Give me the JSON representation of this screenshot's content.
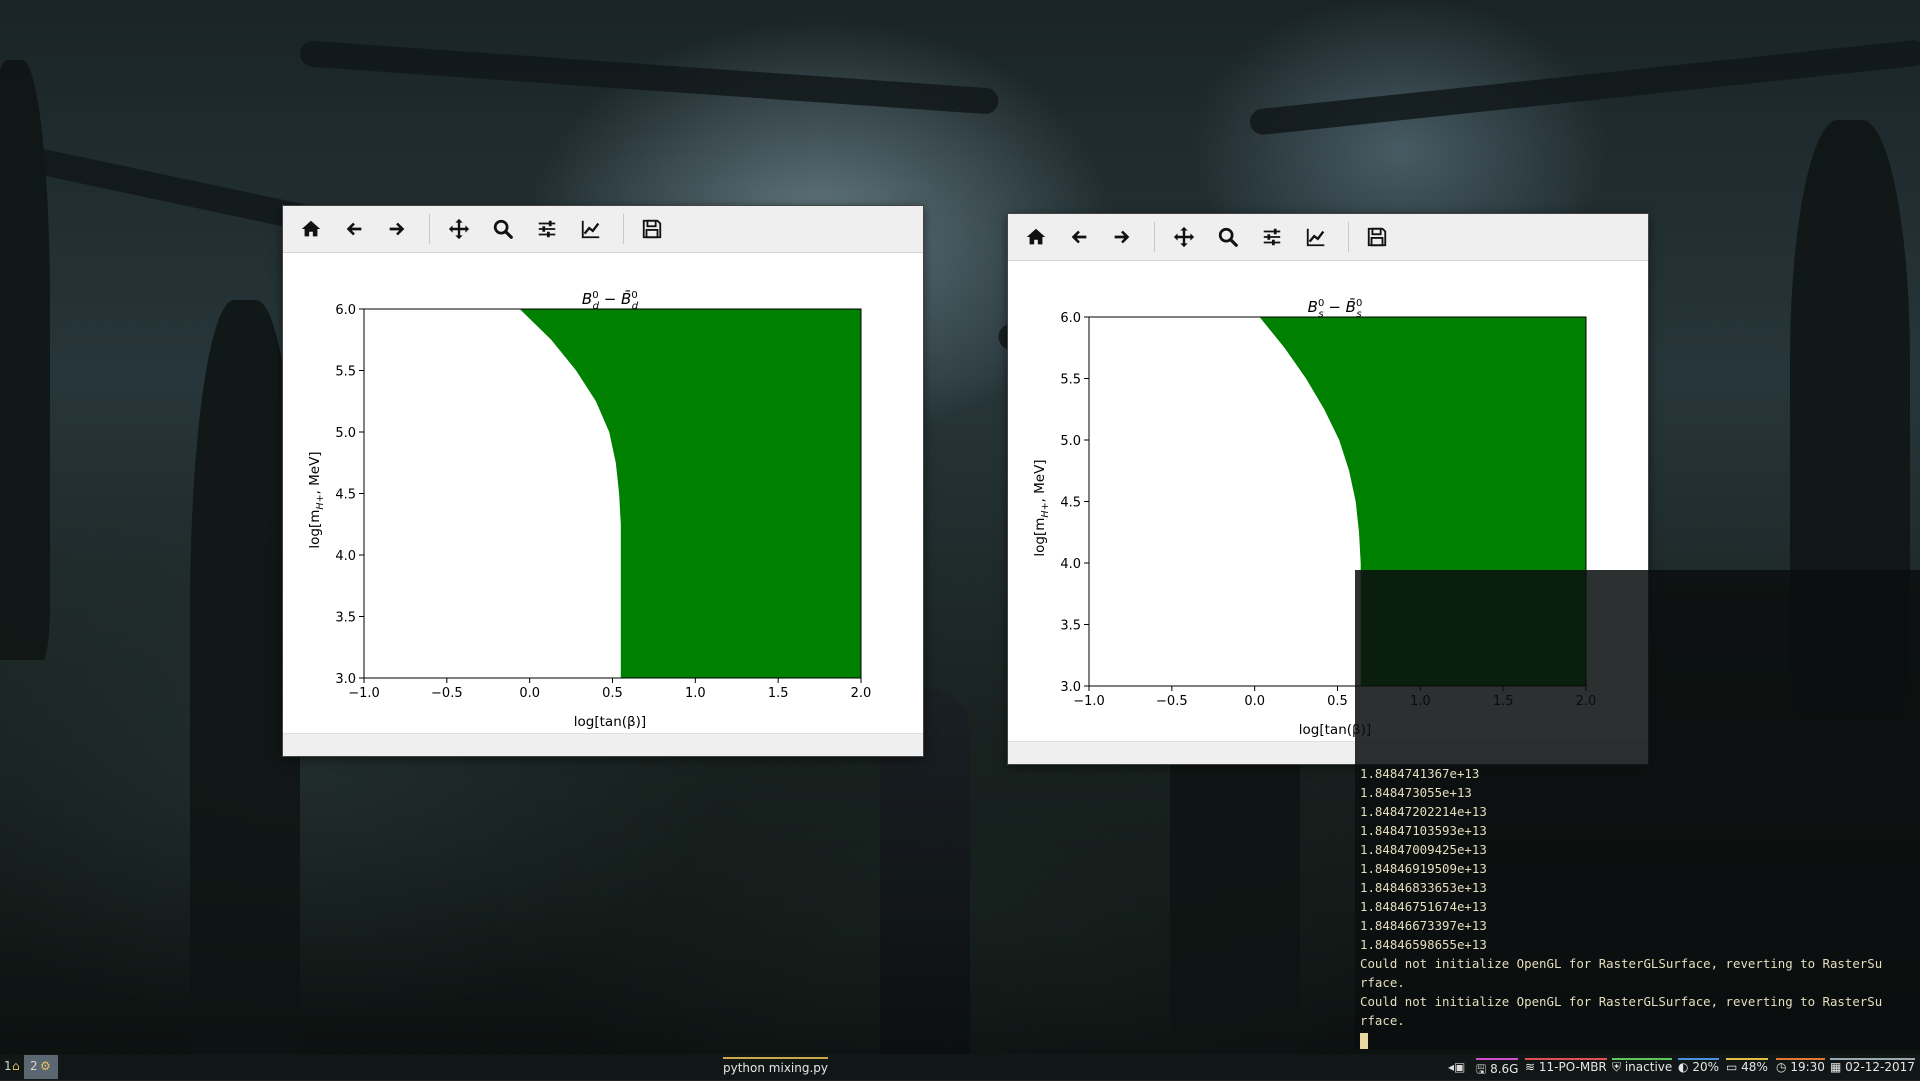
{
  "windows": [
    {
      "id": "bd",
      "title_main": "B",
      "title_sup1": "0",
      "title_sub1": "d",
      "title_minus": " − ",
      "title_main2": "B̄",
      "title_sup2": "0",
      "title_sub2": "d",
      "xlabel": "log[tan(β)]",
      "ylabel_pre": "log[m",
      "ylabel_sub": "H+",
      "ylabel_post": ", MeV]"
    },
    {
      "id": "bs",
      "title_main": "B",
      "title_sup1": "0",
      "title_sub1": "s",
      "title_minus": " − ",
      "title_main2": "B̄",
      "title_sup2": "0",
      "title_sub2": "s",
      "xlabel": "log[tan(β)]",
      "ylabel_pre": "log[m",
      "ylabel_sub": "H+",
      "ylabel_post": ", MeV]"
    }
  ],
  "chart_data": [
    {
      "type": "area",
      "title": "B_d^0 − B̄_d^0",
      "xlabel": "log[tan(β)]",
      "ylabel": "log[m_H+, MeV]",
      "xlim": [
        -1.0,
        2.0
      ],
      "ylim": [
        3.0,
        6.0
      ],
      "xticks": [
        "−1.0",
        "−0.5",
        "0.0",
        "0.5",
        "1.0",
        "1.5",
        "2.0"
      ],
      "yticks": [
        "3.0",
        "3.5",
        "4.0",
        "4.5",
        "5.0",
        "5.5",
        "6.0"
      ],
      "fill_color": "#008000",
      "boundary_x": [
        0.55,
        0.55,
        0.55,
        0.55,
        0.54,
        0.52,
        0.48,
        0.4,
        0.28,
        0.13,
        -0.06
      ],
      "boundary_y": [
        3.0,
        3.5,
        4.0,
        4.25,
        4.5,
        4.75,
        5.0,
        5.25,
        5.5,
        5.75,
        6.0
      ]
    },
    {
      "type": "area",
      "title": "B_s^0 − B̄_s^0",
      "xlabel": "log[tan(β)]",
      "ylabel": "log[m_H+, MeV]",
      "xlim": [
        -1.0,
        2.0
      ],
      "ylim": [
        3.0,
        6.0
      ],
      "xticks": [
        "−1.0",
        "−0.5",
        "0.0",
        "0.5",
        "1.0",
        "1.5",
        "2.0"
      ],
      "yticks": [
        "3.0",
        "3.5",
        "4.0",
        "4.5",
        "5.0",
        "5.5",
        "6.0"
      ],
      "fill_color": "#008000",
      "boundary_x": [
        0.64,
        0.64,
        0.64,
        0.63,
        0.61,
        0.57,
        0.51,
        0.42,
        0.31,
        0.18,
        0.03
      ],
      "boundary_y": [
        3.0,
        3.5,
        4.0,
        4.25,
        4.5,
        4.75,
        5.0,
        5.25,
        5.5,
        5.75,
        6.0
      ]
    }
  ],
  "terminal": {
    "lines": [
      "1.8484741367e+13",
      "1.848473055e+13",
      "1.84847202214e+13",
      "1.84847103593e+13",
      "1.84847009425e+13",
      "1.84846919509e+13",
      "1.84846833653e+13",
      "1.84846751674e+13",
      "1.84846673397e+13",
      "1.84846598655e+13",
      "Could not initialize OpenGL for RasterGLSurface, reverting to RasterSu",
      "rface.",
      "Could not initialize OpenGL for RasterGLSurface, reverting to RasterSu",
      "rface."
    ]
  },
  "taskbar": {
    "ws1": "1",
    "ws2": "2",
    "window_title": "python mixing.py",
    "disk": "8.6G",
    "wifi": "11-PO-MBR",
    "vpn": "inactive",
    "cpu": "20%",
    "battery": "48%",
    "time": "19:30",
    "date": "02-12-2017",
    "colors": {
      "wifi": "#e05050",
      "vpn": "#5cc85c",
      "cpu": "#4a8fe0",
      "disk": "#d050d0",
      "battery": "#e0c040"
    }
  }
}
